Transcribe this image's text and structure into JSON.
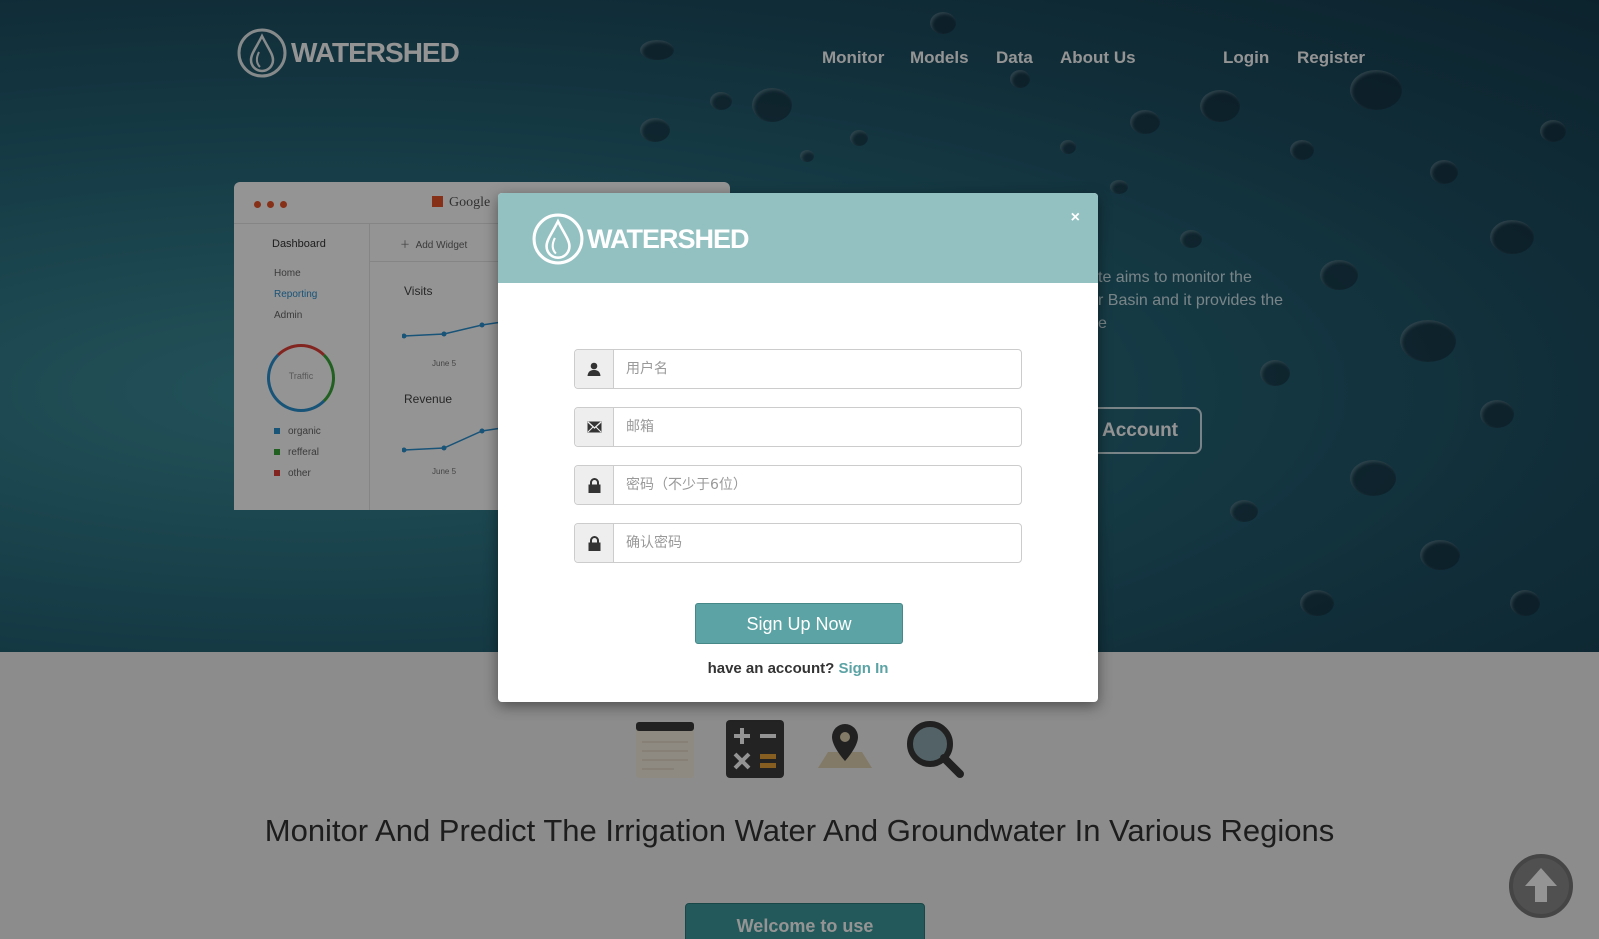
{
  "brand": {
    "name": "WATERSHED"
  },
  "nav": {
    "items": [
      "Monitor",
      "Models",
      "Data",
      "About Us"
    ],
    "login": "Login",
    "register": "Register"
  },
  "mockup": {
    "browser_tab": "Google",
    "sidebar_title": "Dashboard",
    "sidebar_items": [
      "Home",
      "Reporting",
      "Admin"
    ],
    "ring_label": "Traffic",
    "legend": [
      "organic",
      "refferal",
      "other"
    ],
    "add_widget": "Add Widget",
    "chart1_title": "Visits",
    "chart1_xlabel": "June 5",
    "chart2_title": "Revenue",
    "chart2_xlabel": "June 5"
  },
  "hero": {
    "text_lines": [
      "te aims to monitor the",
      "r Basin and it provides the",
      "e"
    ],
    "account_button": "Account"
  },
  "features": {
    "icons": [
      "notepad-icon",
      "calculator-icon",
      "map-pin-icon",
      "magnifier-icon"
    ],
    "tagline": "Monitor And Predict The Irrigation Water And Groundwater In Various Regions",
    "welcome_button": "Welcome to use"
  },
  "modal": {
    "close_label": "×",
    "fields": [
      {
        "icon": "user-icon",
        "placeholder": "用户名"
      },
      {
        "icon": "envelope-icon",
        "placeholder": "邮箱"
      },
      {
        "icon": "lock-icon",
        "placeholder": "密码（不少于6位）"
      },
      {
        "icon": "lock-icon",
        "placeholder": "确认密码"
      }
    ],
    "submit": "Sign Up Now",
    "have_account": "have an account?",
    "sign_in": "Sign In"
  },
  "colors": {
    "modal_header": "#93c0c1",
    "primary_button": "#5ba3a4",
    "link": "#5ba3a4"
  }
}
